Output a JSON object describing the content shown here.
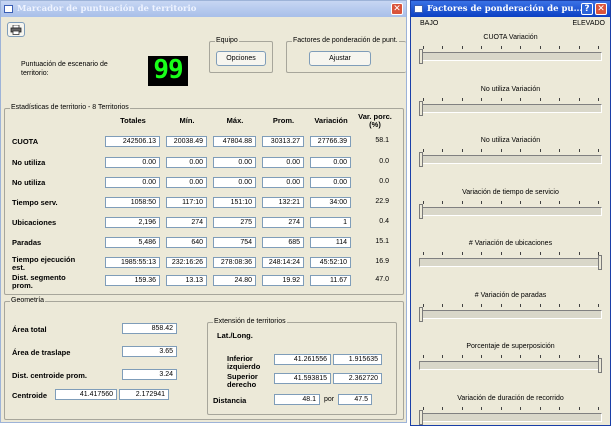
{
  "main_window": {
    "title": "Marcador de puntuación de territorio",
    "score_label": "Puntuación de escenario de territorio:",
    "score_value": "99",
    "equipo": {
      "group_label": "Equipo",
      "button": "Opciones"
    },
    "factores": {
      "group_label": "Factores de ponderación de punt.",
      "button": "Ajustar"
    },
    "stats": {
      "group_label": "Estadísticas de territorio - 8 Territorios",
      "headers": [
        "Totales",
        "Mín.",
        "Máx.",
        "Prom.",
        "Variación",
        "Var. porc. (%)"
      ],
      "rows": [
        {
          "label": "CUOTA",
          "values": [
            "242506.13",
            "20038.49",
            "47804.88",
            "30313.27",
            "27766.39",
            "58.1"
          ]
        },
        {
          "label": "No utiliza",
          "values": [
            "0.00",
            "0.00",
            "0.00",
            "0.00",
            "0.00",
            "0.0"
          ]
        },
        {
          "label": "No utiliza",
          "values": [
            "0.00",
            "0.00",
            "0.00",
            "0.00",
            "0.00",
            "0.0"
          ]
        },
        {
          "label": "Tiempo serv.",
          "values": [
            "1058:50",
            "117:10",
            "151:10",
            "132:21",
            "34:00",
            "22.9"
          ]
        },
        {
          "label": "Ubicaciones",
          "values": [
            "2,196",
            "274",
            "275",
            "274",
            "1",
            "0.4"
          ]
        },
        {
          "label": "Paradas",
          "values": [
            "5,486",
            "640",
            "754",
            "685",
            "114",
            "15.1"
          ]
        },
        {
          "label": "Tiempo ejecución est.",
          "values": [
            "1985:55:13",
            "232:16:26",
            "278:08:36",
            "248:14:24",
            "45:52:10",
            "16.9"
          ]
        },
        {
          "label": "Dist. segmento prom.",
          "values": [
            "159.36",
            "13.13",
            "24.80",
            "19.92",
            "11.67",
            "47.0"
          ]
        }
      ]
    },
    "geometry": {
      "group_label": "Geometría",
      "area_total_label": "Área total",
      "area_total": "858.42",
      "area_traslape_label": "Área de traslape",
      "area_traslape": "3.65",
      "dist_centroide_label": "Dist. centroide prom.",
      "dist_centroide": "3.24",
      "centroide_label": "Centroide",
      "centroide_lat": "41.417560",
      "centroide_lon": "2.172941",
      "extension": {
        "group_label": "Extensión de territorios",
        "latlong_label": "Lat./Long.",
        "inferior_label": "Inferior izquierdo",
        "inferior_lat": "41.261556",
        "inferior_lon": "1.915635",
        "superior_label": "Superior derecho",
        "superior_lat": "41.593815",
        "superior_lon": "2.362720",
        "distancia_label": "Distancia",
        "distancia_a": "48.1",
        "por_label": "por",
        "distancia_b": "47.5"
      }
    }
  },
  "weights_window": {
    "title": "Factores de ponderación de pu...",
    "low_label": "BAJO",
    "high_label": "ELEVADO",
    "sliders": [
      {
        "label": "CUOTA Variación",
        "value": 0.0
      },
      {
        "label": "No utiliza Variación",
        "value": 0.0
      },
      {
        "label": "No utiliza Variación",
        "value": 0.0
      },
      {
        "label": "Variación de tiempo de servicio",
        "value": 0.0
      },
      {
        "label": "# Variación de ubicaciones",
        "value": 1.0
      },
      {
        "label": "# Variación de paradas",
        "value": 0.0
      },
      {
        "label": "Porcentaje de superposición",
        "value": 1.0
      },
      {
        "label": "Variación de duración de recorrido",
        "value": 0.0
      }
    ]
  },
  "colors": {
    "lcd_digits": "#19ff19",
    "titlebar_active": "#0b3fc2",
    "close_button": "#d9533b"
  }
}
